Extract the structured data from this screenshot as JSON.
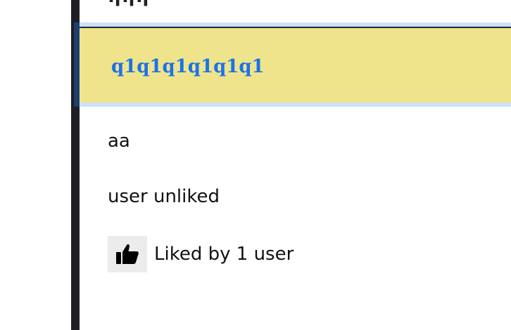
{
  "page": {
    "top_title_fragment": "ηηη"
  },
  "post": {
    "title": "q1q1q1q1q1q1",
    "body": "aa",
    "status": "user unliked",
    "like_icon": "thumbs-up-icon",
    "likes_text": "Liked by 1 user"
  },
  "colors": {
    "title_band": "#efe38c",
    "title_text": "#1a73e8",
    "header_outline": "#cfe0f6",
    "accent_bar": "#1c3f72",
    "left_bar": "#1e1f22",
    "like_button_bg": "#ececec"
  }
}
